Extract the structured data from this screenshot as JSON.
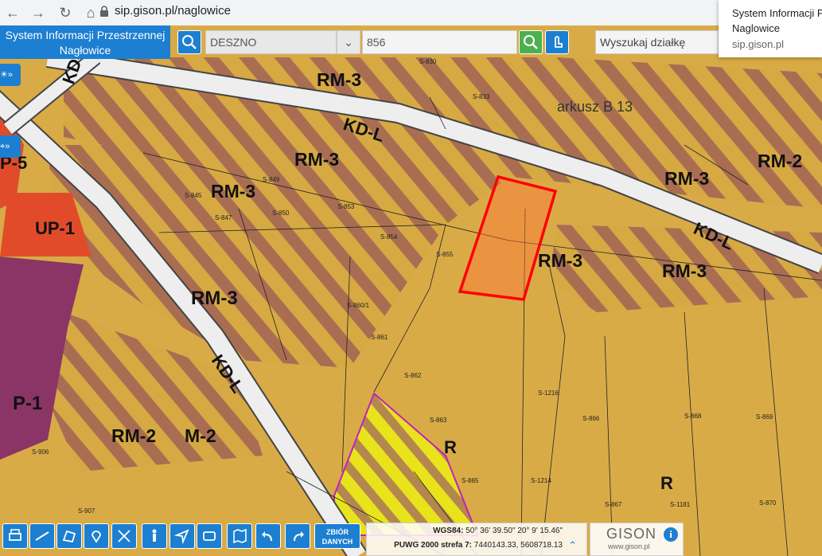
{
  "browser": {
    "url": "sip.gison.pl/naglowice",
    "popup": {
      "title_line1": "System Informacji P",
      "title_line2": "Naglowice",
      "domain": "sip.gison.pl"
    }
  },
  "header": {
    "title_line1": "System Informacji Przestrzennej",
    "title_line2": "Nagłowice",
    "precinct_value": "DESZNO",
    "parcel_value": "856",
    "search_placeholder": "Wyszukaj działkę"
  },
  "map": {
    "zone_labels": [
      "RM-3",
      "RM-3",
      "RM-3",
      "RM-3",
      "RM-3",
      "RM-3",
      "RM-2",
      "RM-2",
      "M-2",
      "UP-1",
      "P-1",
      "R",
      "R",
      "KD-L",
      "KD-L",
      "KD-L",
      "KD-L",
      "P-5"
    ],
    "sheet_label": "arkusz B 13",
    "parcel_numbers": [
      "S-830",
      "S-833",
      "S-849",
      "S-850",
      "S-853",
      "S-854",
      "S-855",
      "S-845",
      "S-847",
      "S-860/1",
      "S-861",
      "S-862",
      "S-863",
      "S-865",
      "S-866",
      "S-868",
      "S-869",
      "S-867",
      "S-870",
      "S-1216",
      "S-1214",
      "S-1181",
      "S-906",
      "S-907"
    ]
  },
  "toolbar": {
    "zbior_line1": "ZBIÓR",
    "zbior_line2": "DANYCH"
  },
  "coords": {
    "wgs_label": "WGS84:",
    "wgs_value": "50° 36' 39.50\" 20° 9' 15.46\"",
    "puwg_label": "PUWG 2000 strefa 7:",
    "puwg_value": "7440143.33, 5608718.13"
  },
  "brand": {
    "name": "GISON",
    "site": "www.gison.pl"
  },
  "colors": {
    "accent": "#1c7fd1",
    "search_green": "#4caf50",
    "rm_base": "#d4a441",
    "rm_stripe": "#a46b4f",
    "selection": "#ff0000"
  }
}
